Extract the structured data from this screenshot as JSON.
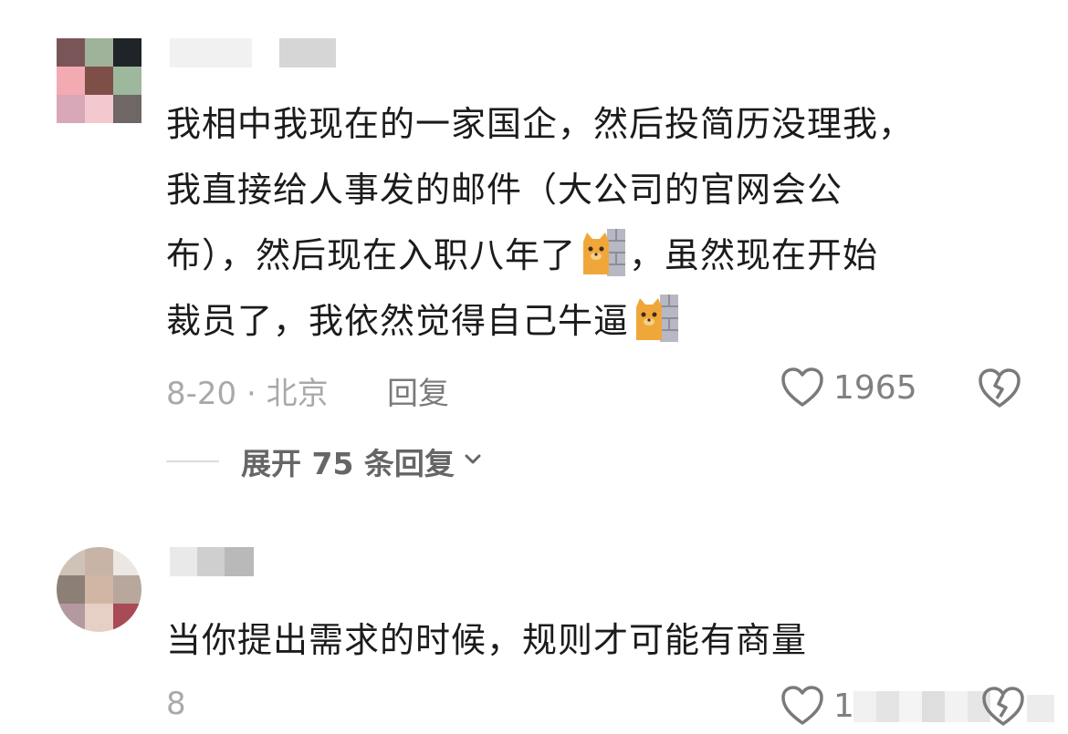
{
  "comments": [
    {
      "text_lines": [
        "我相中我现在的一家国企，然后投简历没理我，",
        "我直接给人事发的邮件（大公司的官网会公",
        "布），然后现在入职八年了",
        "，虽然现在开始",
        "裁员了，我依然觉得自己牛逼"
      ],
      "date_location": "8-20 · 北京",
      "reply_label": "回复",
      "like_count": "1965",
      "expand_label": "展开 75 条回复"
    },
    {
      "text_lines": [
        "当你提出需求的时候，规则才可能有商量"
      ],
      "date_location": "8",
      "like_count": "1"
    }
  ],
  "icons": {
    "like": "heart-outline-icon",
    "dislike": "broken-heart-icon",
    "emoji": "cat-behind-wall-emoji",
    "expand": "chevron-down-icon"
  },
  "colors": {
    "text": "#1b1b1b",
    "meta": "#a9a9a9",
    "icon": "#7a7a7a"
  }
}
